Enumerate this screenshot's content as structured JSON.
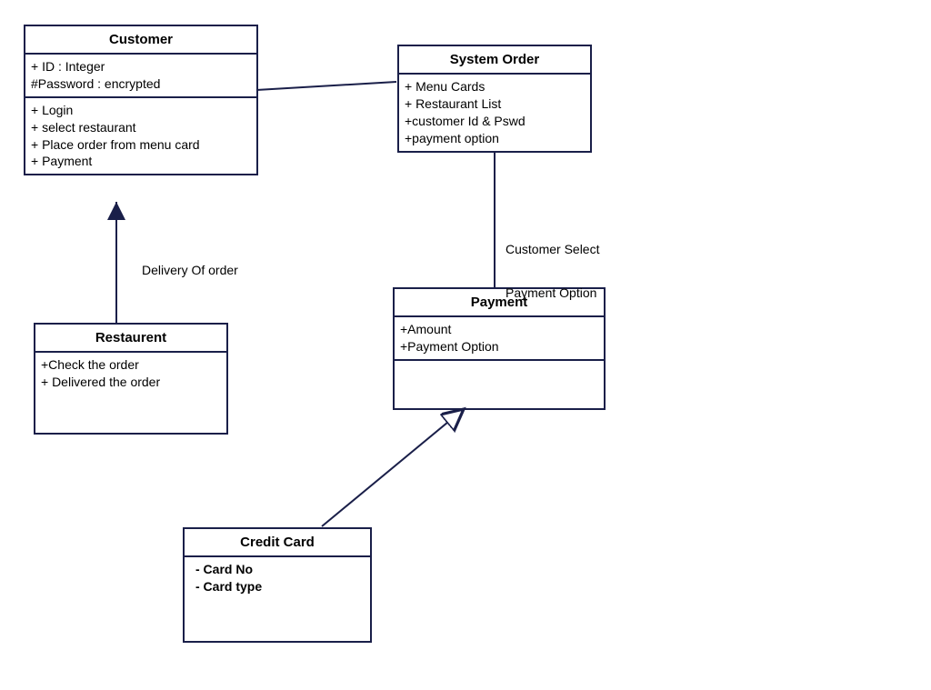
{
  "classes": {
    "customer": {
      "title": "Customer",
      "attrs": [
        "+ ID : Integer",
        "#Password : encrypted"
      ],
      "ops": [
        "+ Login",
        "+ select restaurant",
        "+  Place order from menu card",
        "+ Payment"
      ]
    },
    "systemOrder": {
      "title": "System Order",
      "attrs": [
        "+ Menu Cards",
        "+ Restaurant List",
        "+customer Id & Pswd",
        "+payment option"
      ]
    },
    "restaurant": {
      "title": "Restaurent",
      "attrs": [
        "+Check the order",
        "+ Delivered the order"
      ]
    },
    "payment": {
      "title": "Payment",
      "attrs": [
        "+Amount",
        "+Payment Option"
      ]
    },
    "creditCard": {
      "title": "Credit Card",
      "attrs": [
        "- Card No",
        "- Card type"
      ]
    }
  },
  "labels": {
    "deliveryOfOrder": "Delivery Of order",
    "selectPaymentLine1": "Customer Select",
    "selectPaymentLine2": "Payment Option"
  }
}
